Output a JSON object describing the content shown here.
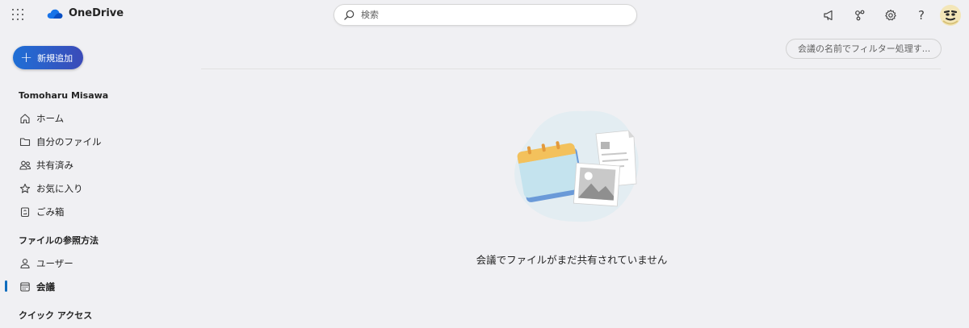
{
  "app": {
    "name": "OneDrive"
  },
  "search": {
    "placeholder": "検索"
  },
  "toolbar": {
    "icons": [
      "megaphone-icon",
      "share-network-icon",
      "gear-icon",
      "help-icon"
    ],
    "help_glyph": "?"
  },
  "sidebar": {
    "new_button": {
      "plus": "+",
      "label": "新規追加"
    },
    "user_name": "Tomoharu Misawa",
    "items": [
      {
        "label": "ホーム",
        "icon": "home-icon"
      },
      {
        "label": "自分のファイル",
        "icon": "folder-icon"
      },
      {
        "label": "共有済み",
        "icon": "people-icon"
      },
      {
        "label": "お気に入り",
        "icon": "star-icon"
      },
      {
        "label": "ごみ箱",
        "icon": "recycle-bin-icon"
      }
    ],
    "browse_section": "ファイルの参照方法",
    "browse_items": [
      {
        "label": "ユーザー",
        "icon": "person-icon"
      },
      {
        "label": "会議",
        "icon": "calendar-icon",
        "active": true
      }
    ],
    "quick_access": "クイック アクセス"
  },
  "main": {
    "filter_placeholder": "会議の名前でフィルター処理す...",
    "empty_message": "会議でファイルがまだ共有されていません"
  },
  "colors": {
    "accent": "#0f6cbd",
    "new_button_start": "#1f6fd6",
    "new_button_end": "#3b4bb8",
    "background": "#f0f0f3"
  }
}
